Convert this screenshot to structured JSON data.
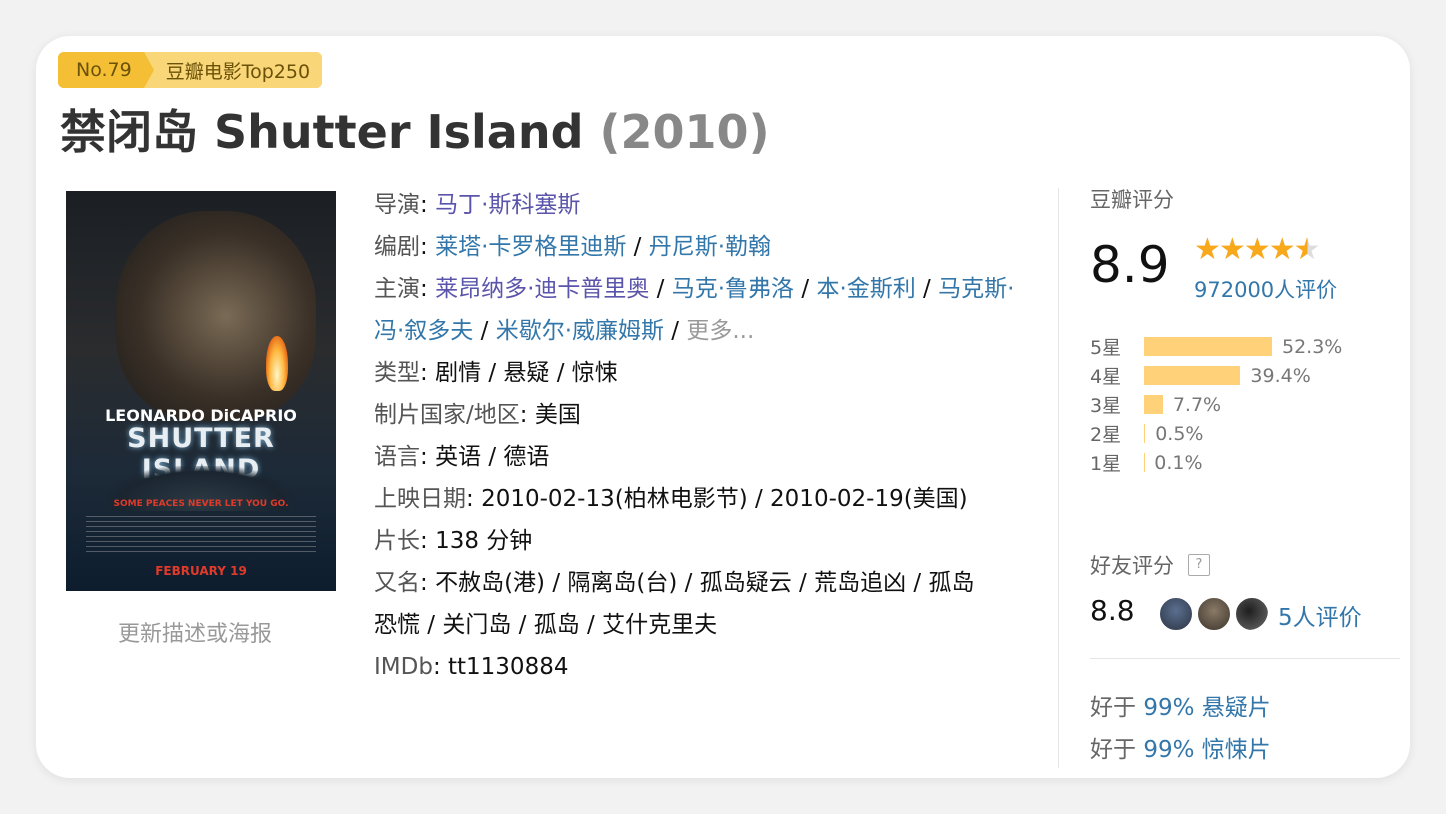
{
  "badge": {
    "rank_no": "No.79",
    "list_name": "豆瓣电影Top250"
  },
  "title": {
    "name": "禁闭岛 Shutter Island",
    "year": "(2010)"
  },
  "poster": {
    "actor": "LEONARDO DiCAPRIO",
    "movie": "SHUTTER ISLAND",
    "tagline": "SOME PEACES NEVER LET YOU GO.",
    "release": "FEBRUARY 19",
    "update_link": "更新描述或海报"
  },
  "info": {
    "director": {
      "label": "导演",
      "names": [
        "马丁·斯科塞斯"
      ]
    },
    "writers": {
      "label": "编剧",
      "names": [
        "莱塔·卡罗格里迪斯",
        "丹尼斯·勒翰"
      ]
    },
    "cast": {
      "label": "主演",
      "names": [
        "莱昂纳多·迪卡普里奥",
        "马克·鲁弗洛",
        "本·金斯利",
        "马克斯·冯·叙多夫",
        "米歇尔·威廉姆斯"
      ],
      "more": "更多..."
    },
    "genre": {
      "label": "类型",
      "value": "剧情 / 悬疑 / 惊悚"
    },
    "country": {
      "label": "制片国家/地区",
      "value": "美国"
    },
    "language": {
      "label": "语言",
      "value": "英语 / 德语"
    },
    "release": {
      "label": "上映日期",
      "value": "2010-02-13(柏林电影节) / 2010-02-19(美国)"
    },
    "runtime": {
      "label": "片长",
      "value": "138 分钟"
    },
    "aka": {
      "label": "又名",
      "line1": "不赦岛(港) / 隔离岛(台) / 孤岛疑云 / 荒岛追凶 / 孤岛",
      "line2": "恐慌 / 关门岛 / 孤岛 / 艾什克里夫"
    },
    "imdb": {
      "label": "IMDb",
      "value": "tt1130884"
    }
  },
  "rating": {
    "label": "豆瓣评分",
    "score": "8.9",
    "stars": 4.5,
    "votes": "972000人评价",
    "distribution": [
      {
        "label": "5星",
        "pct": "52.3%",
        "value": 52.3
      },
      {
        "label": "4星",
        "pct": "39.4%",
        "value": 39.4
      },
      {
        "label": "3星",
        "pct": "7.7%",
        "value": 7.7
      },
      {
        "label": "2星",
        "pct": "0.5%",
        "value": 0.5
      },
      {
        "label": "1星",
        "pct": "0.1%",
        "value": 0.1
      }
    ],
    "bar_color": "#ffd27a",
    "star_color": "#f7a81b"
  },
  "friends": {
    "label": "好友评分",
    "help": "?",
    "score": "8.8",
    "votes": "5人评价"
  },
  "better_than": [
    {
      "prefix": "好于",
      "pct": "99%",
      "genre": "悬疑片"
    },
    {
      "prefix": "好于",
      "pct": "99%",
      "genre": "惊悚片"
    }
  ],
  "colors": {
    "link": "#3377aa",
    "director_link": "#5a55aa",
    "badge": "#f7c948"
  }
}
